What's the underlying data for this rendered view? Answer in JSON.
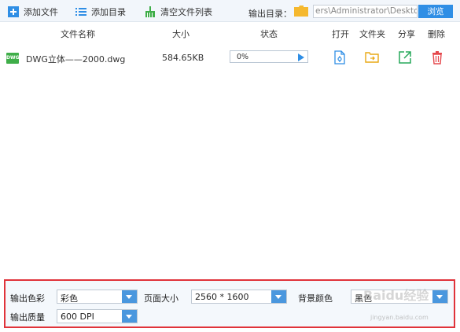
{
  "toolbar": {
    "add_file": "添加文件",
    "add_dir": "添加目录",
    "clear_list": "清空文件列表",
    "output_dir_label": "输出目录：",
    "output_path": "ers\\Administrator\\Desktop",
    "browse": "浏览"
  },
  "table": {
    "headers": {
      "name": "文件名称",
      "size": "大小",
      "status": "状态",
      "open": "打开",
      "folder": "文件夹",
      "share": "分享",
      "delete": "删除"
    },
    "rows": [
      {
        "icon": "DWG",
        "name": "DWG立体——2000.dwg",
        "size": "584.65KB",
        "progress_text": "0%",
        "progress": 0
      }
    ]
  },
  "settings": {
    "color_label": "输出色彩",
    "color_value": "彩色",
    "page_label": "页面大小",
    "page_value": "2560 * 1600",
    "bg_label": "背景颜色",
    "bg_value": "黑色",
    "quality_label": "输出质量",
    "quality_value": "600 DPI"
  },
  "watermark": {
    "brand": "Baidu经验",
    "url": "jingyan.baidu.com"
  },
  "colors": {
    "accent": "#2f8ee5",
    "highlight_border": "#e0333a",
    "file_badge": "#3fae49"
  }
}
